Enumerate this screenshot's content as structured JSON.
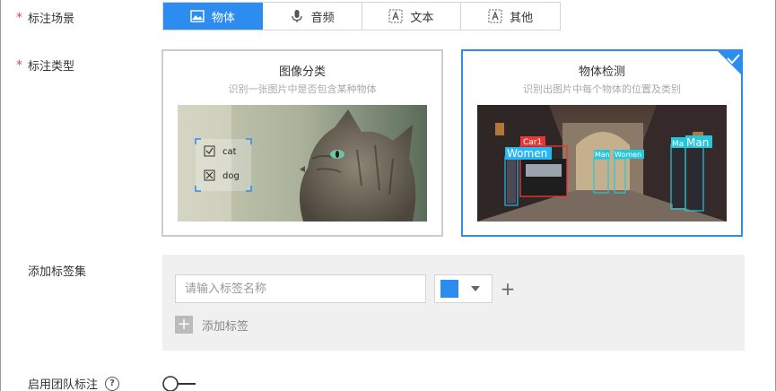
{
  "scene": {
    "label": "标注场景",
    "required_mark": "*",
    "options": [
      {
        "label": "物体",
        "icon": "image-icon",
        "active": true
      },
      {
        "label": "音频",
        "icon": "microphone-icon",
        "active": false
      },
      {
        "label": "文本",
        "icon": "text-icon",
        "active": false
      },
      {
        "label": "其他",
        "icon": "text-icon",
        "active": false
      }
    ]
  },
  "type": {
    "label": "标注类型",
    "required_mark": "*",
    "cards": [
      {
        "title": "图像分类",
        "desc": "识别一张图片中是否包含某种物体",
        "tags": [
          "cat",
          "dog"
        ]
      },
      {
        "title": "物体检测",
        "desc": "识别出图片中每个物体的位置及类别",
        "boxes": [
          "Car1",
          "Women",
          "Man",
          "Women",
          "Ma",
          "Man"
        ]
      }
    ]
  },
  "labelset": {
    "label": "添加标签集",
    "input_placeholder": "请输入标签名称",
    "color": "#2d8cf0",
    "plus": "+",
    "add_label": "添加标签"
  },
  "team": {
    "label": "启用团队标注",
    "help": "?"
  },
  "colors": {
    "accent": "#2d8cf0",
    "required": "#e84c3d"
  }
}
